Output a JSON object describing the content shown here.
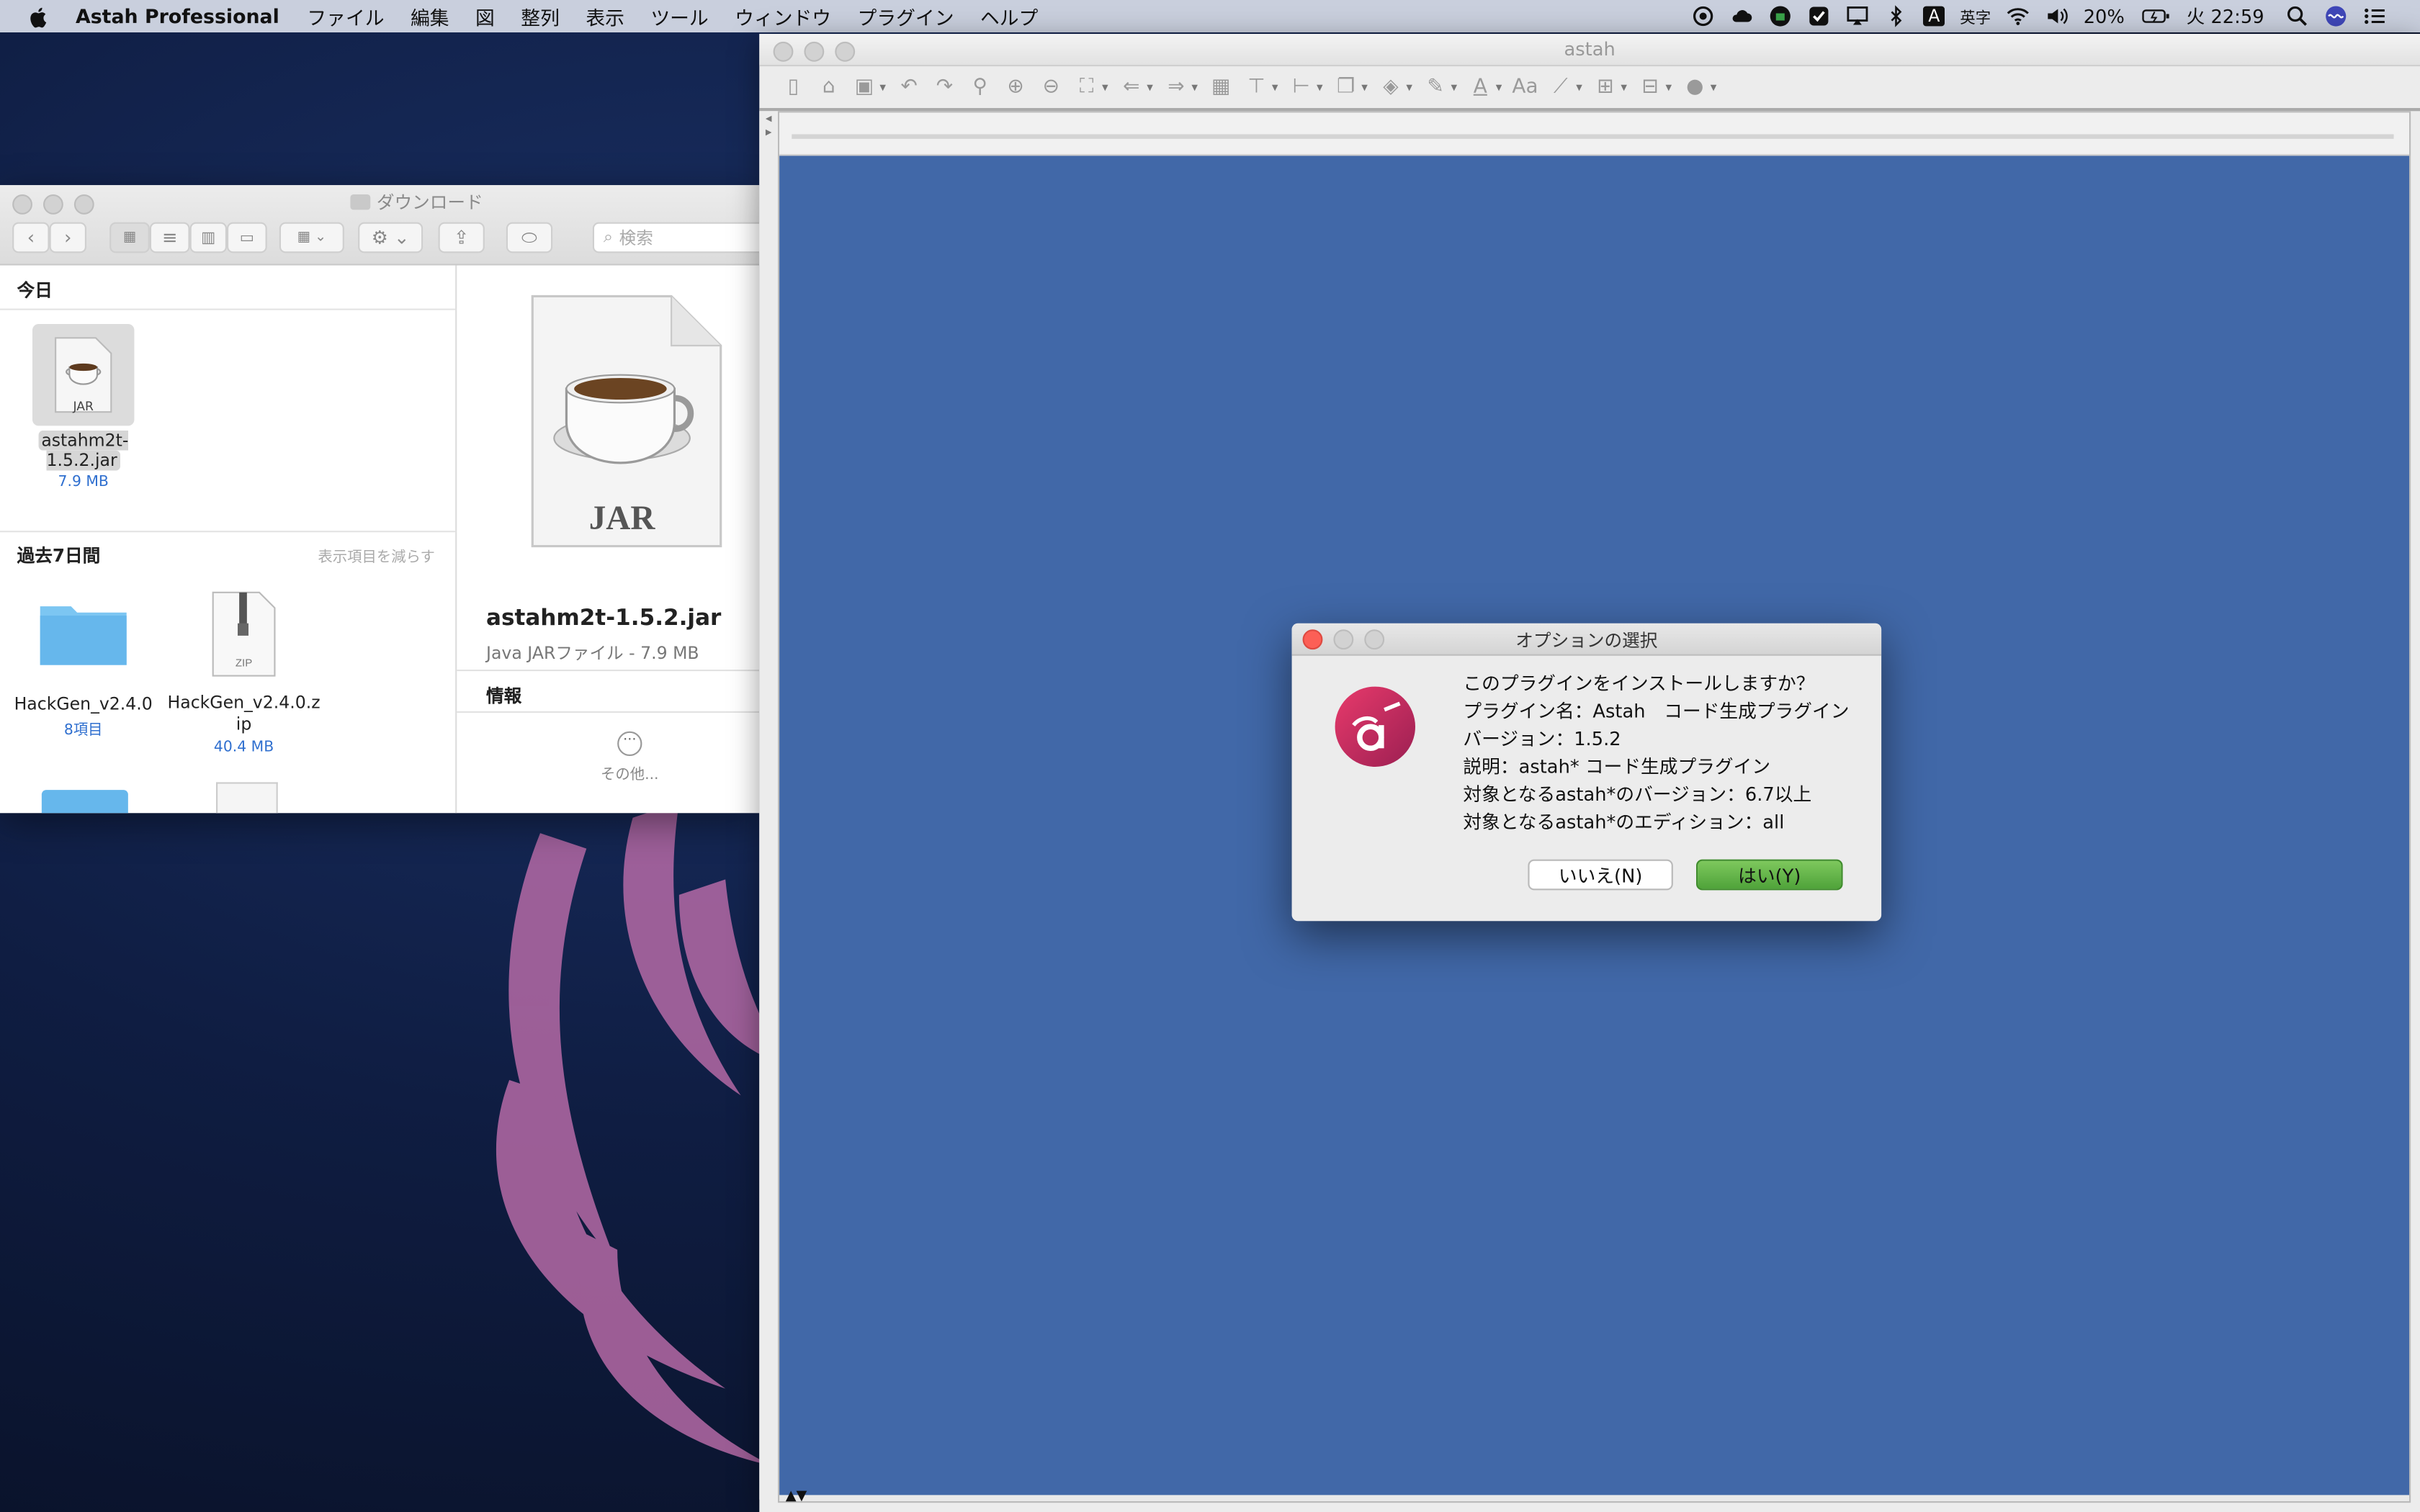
{
  "menubar": {
    "app_name": "Astah Professional",
    "items": [
      "ファイル",
      "編集",
      "図",
      "整列",
      "表示",
      "ツール",
      "ウィンドウ",
      "プラグイン",
      "ヘルプ"
    ],
    "status": {
      "input_badge": "A",
      "input_mode": "英字",
      "battery": "20%",
      "clock": "火 22:59"
    }
  },
  "finder": {
    "title": "ダウンロード",
    "search_placeholder": "検索",
    "today_header": "今日",
    "past7_header": "過去7日間",
    "show_less": "表示項目を減らす",
    "today_files": [
      {
        "name": "astahm2t-1.5.2.jar",
        "meta": "7.9 MB",
        "badge": "JAR"
      }
    ],
    "past_files": [
      {
        "name": "HackGen_v2.4.0",
        "meta": "8項目"
      },
      {
        "name": "HackGen_v2.4.0.z\nip",
        "meta": "40.4 MB",
        "badge": "ZIP"
      }
    ],
    "preview": {
      "badge": "JAR",
      "name": "astahm2t-1.5.2.jar",
      "kind": "Java JARファイル - 7.9 MB",
      "info_header": "情報",
      "more_label": "その他..."
    }
  },
  "astah": {
    "title": "astah"
  },
  "dialog": {
    "title": "オプションの選択",
    "lines": [
      "このプラグインをインストールしますか？",
      "プラグイン名：Astah　コード生成プラグイン",
      "バージョン：1.5.2",
      "説明：astah* コード生成プラグイン",
      "対象となるastah*のバージョン：6.7以上",
      "対象となるastah*のエディション：all"
    ],
    "no_label": "いいえ(N)",
    "yes_label": "はい(Y)"
  },
  "colors": {
    "canvas": "#4168a8",
    "yes_button": "#5fb244",
    "close_red": "#fc5f56"
  }
}
